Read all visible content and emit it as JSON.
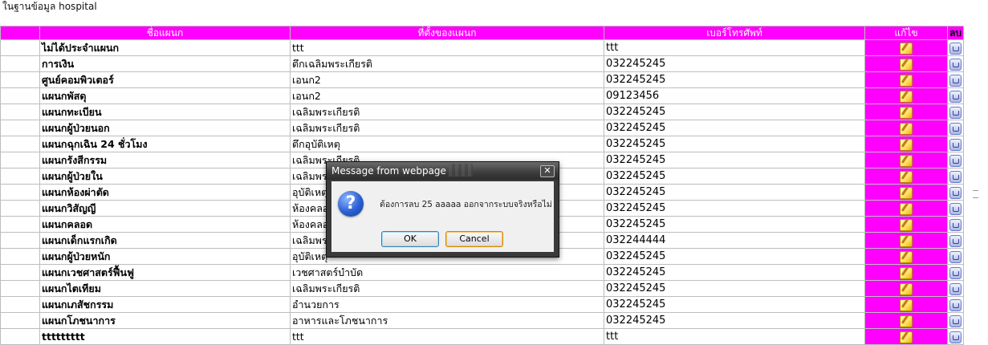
{
  "page": {
    "heading": "ในฐานข้อมูล hospital"
  },
  "table": {
    "headers": {
      "name": "ชื่อแผนก",
      "location": "ที่ตั้งของแผนก",
      "phone": "เบอร์โทรศัพท์",
      "edit": "แก้ไข",
      "delete": "ลบ"
    },
    "rows": [
      {
        "name": "ไม่ได้ประจำแผนก",
        "location": "ttt",
        "phone": "ttt"
      },
      {
        "name": "การเงิน",
        "location": "ตึกเฉลิมพระเกียรติ",
        "phone": "032245245"
      },
      {
        "name": "ศูนย์คอมพิวเตอร์",
        "location": "เอนก2",
        "phone": "032245245"
      },
      {
        "name": "แผนกพัสดุ",
        "location": "เอนก2",
        "phone": "09123456"
      },
      {
        "name": "แผนกทะเบียน",
        "location": "เฉลิมพระเกียรติ",
        "phone": "032245245"
      },
      {
        "name": "แผนกผู้ป่วยนอก",
        "location": "เฉลิมพระเกียรติ",
        "phone": "032245245"
      },
      {
        "name": "แผนกฉุกเฉิน 24 ชั่วโมง",
        "location": "ตึกอุบัติเหตุ",
        "phone": "032245245"
      },
      {
        "name": "แผนกรังสีกรรม",
        "location": "เฉลิมพระเกียรติ",
        "phone": "032245245"
      },
      {
        "name": "แผนกผู้ป่วยใน",
        "location": "เฉลิมพระเกียรติ",
        "phone": "032245245"
      },
      {
        "name": "แผนกห้องผ่าตัด",
        "location": "อุบัติเหตุ",
        "phone": "032245245"
      },
      {
        "name": "แผนกวิสัญญี",
        "location": "ห้องคลอด",
        "phone": "032245245"
      },
      {
        "name": "แผนกคลอด",
        "location": "ห้องคลอด",
        "phone": "032245245"
      },
      {
        "name": "แผนกเด็กแรกเกิด",
        "location": "เฉลิมพระเกียรติ",
        "phone": "032244444"
      },
      {
        "name": "แผนกผู้ป่วยหนัก",
        "location": "อุบัติเหตุ",
        "phone": "032245245"
      },
      {
        "name": "แผนกเวชศาสตร์ฟื้นฟู",
        "location": "เวชศาสตร์บำบัด",
        "phone": "032245245"
      },
      {
        "name": "แผนกไตเทียม",
        "location": "เฉลิมพระเกียรติ",
        "phone": "032245245"
      },
      {
        "name": "แผนกเภสัชกรรม",
        "location": "อำนวยการ",
        "phone": "032245245"
      },
      {
        "name": "แผนกโภชนาการ",
        "location": "อาหารและโภชนาการ",
        "phone": "032245245"
      },
      {
        "name": "ttttttttt",
        "location": "ttt",
        "phone": "ttt"
      }
    ]
  },
  "dialog": {
    "title": "Message from webpage",
    "close_glyph": "✕",
    "icon_glyph": "?",
    "message": "ต้องการลบ 25 aaaaa ออกจากระบบจริงหรือไม่",
    "ok_label": "OK",
    "cancel_label": "Cancel"
  }
}
